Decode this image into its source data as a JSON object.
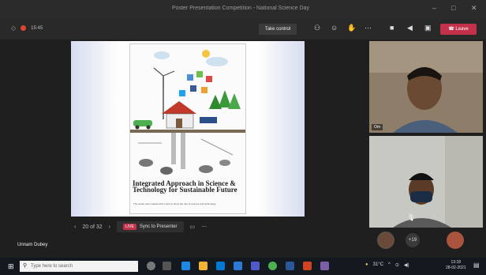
{
  "window": {
    "title": "Poster Presentation Competition - National Science Day"
  },
  "toolbar": {
    "timer": "15:45",
    "take_control": "Take control",
    "leave": "Leave"
  },
  "poster": {
    "title": "Integrated Approach in Science & Technology for Sustainable Future",
    "subtitle": "The poster was created with a view to show the role of science and technology."
  },
  "slide_nav": {
    "page": "20 of 32",
    "live": "LIVE",
    "sync": "Sync to Presenter"
  },
  "presenter": {
    "name": "Unnam Dubey"
  },
  "participants": {
    "video1_name": "Om",
    "more_count": "+19"
  },
  "taskbar": {
    "search_placeholder": "Type here to search",
    "temp": "31°C",
    "time": "13:18",
    "date": "28-02-2021"
  },
  "colors": {
    "accent_red": "#c4314b",
    "bg": "#1f1f1f"
  }
}
